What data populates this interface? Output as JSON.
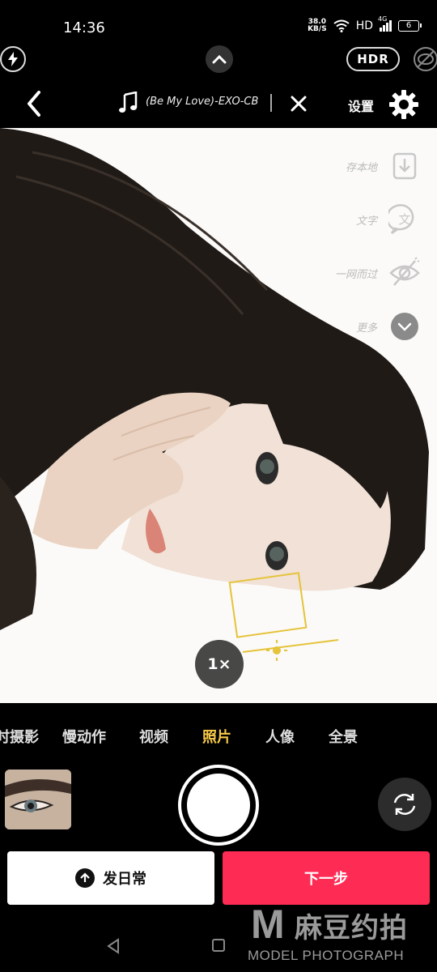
{
  "status_bar": {
    "time": "14:36",
    "net_speed": "38.0",
    "net_unit": "KB/S",
    "hd": "HD",
    "network": "4G",
    "battery": "6"
  },
  "top_controls": {
    "hdr_label": "HDR"
  },
  "header": {
    "song_title": "(Be My Love)-EXO-CB",
    "settings_label": "设置"
  },
  "side_tools": [
    {
      "label": "存本地",
      "icon": "download-icon"
    },
    {
      "label": "文字",
      "icon": "text-icon",
      "glyph": "文"
    },
    {
      "label": "一网而过",
      "icon": "eye-off-icon"
    },
    {
      "label": "更多",
      "icon": "chevron-down-icon"
    }
  ],
  "zoom": "1×",
  "modes": [
    "时摄影",
    "慢动作",
    "视频",
    "照片",
    "人像",
    "全景"
  ],
  "active_mode": "照片",
  "actions": {
    "daily_label": "发日常",
    "next_label": "下一步"
  },
  "watermark": {
    "letter": "M",
    "chinese": "麻豆约拍",
    "english": "MODEL PHOTOGRAPH"
  },
  "colors": {
    "accent": "#fe2c55",
    "active_mode": "#f7c948",
    "focus_box": "#e5c33a"
  }
}
